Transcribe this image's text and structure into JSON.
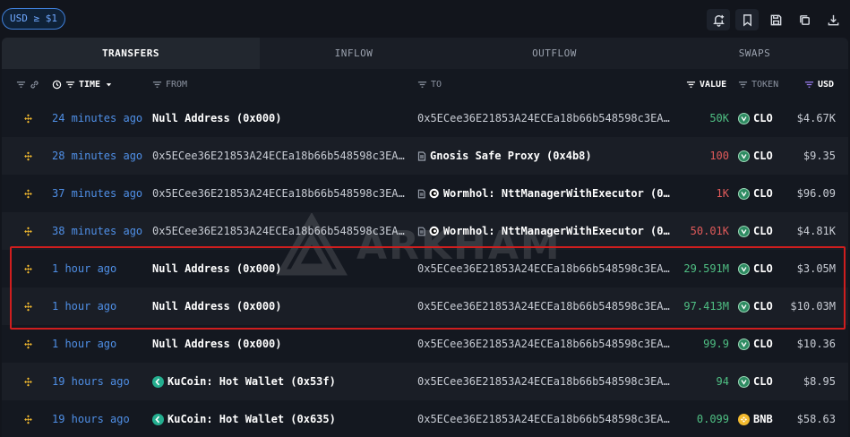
{
  "filter": {
    "label": "USD ≥ $1"
  },
  "toolbar": {
    "icons": [
      "notification-add-icon",
      "bookmark-icon",
      "save-icon",
      "copy-icon",
      "download-icon"
    ]
  },
  "tabs": [
    {
      "label": "TRANSFERS",
      "active": true
    },
    {
      "label": "INFLOW",
      "active": false
    },
    {
      "label": "OUTFLOW",
      "active": false
    },
    {
      "label": "SWAPS",
      "active": false
    }
  ],
  "columns": {
    "time": "TIME",
    "from": "FROM",
    "to": "TO",
    "value": "VALUE",
    "token": "TOKEN",
    "usd": "USD"
  },
  "watermark": "ARKHAM",
  "colors": {
    "accent_blue": "#4f8fe6",
    "positive_green": "#4fbf83",
    "negative_red": "#e05a5a",
    "highlight_red": "#d01e1e",
    "chain_bnb_yellow": "#f3ba2f",
    "kucoin_green": "#24ae8f",
    "clo_token_green": "#2e8b62"
  },
  "rows": [
    {
      "time": "24 minutes ago",
      "from": "Null Address (0x000)",
      "from_type": "entity",
      "to": "0x5ECee36E21853A24ECEa18b66b548598c3EA...",
      "to_type": "address",
      "value": "50K",
      "value_color": "green",
      "token": "CLO",
      "usd": "$4.67K"
    },
    {
      "time": "28 minutes ago",
      "from": "0x5ECee36E21853A24ECEa18b66b548598c3EA...",
      "from_type": "address",
      "to": "Gnosis Safe Proxy (0x4b8)",
      "to_type": "contract",
      "value": "100",
      "value_color": "red",
      "token": "CLO",
      "usd": "$9.35"
    },
    {
      "time": "37 minutes ago",
      "from": "0x5ECee36E21853A24ECEa18b66b548598c3EA...",
      "from_type": "address",
      "to": "Wormhol: NttManagerWithExecutor (0...",
      "to_type": "contract-wormhole",
      "value": "1K",
      "value_color": "red",
      "token": "CLO",
      "usd": "$96.09"
    },
    {
      "time": "38 minutes ago",
      "from": "0x5ECee36E21853A24ECEa18b66b548598c3EA...",
      "from_type": "address",
      "to": "Wormhol: NttManagerWithExecutor (0...",
      "to_type": "contract-wormhole",
      "value": "50.01K",
      "value_color": "red",
      "token": "CLO",
      "usd": "$4.81K"
    },
    {
      "time": "1 hour ago",
      "from": "Null Address (0x000)",
      "from_type": "entity",
      "to": "0x5ECee36E21853A24ECEa18b66b548598c3EA...",
      "to_type": "address",
      "value": "29.591M",
      "value_color": "green",
      "token": "CLO",
      "usd": "$3.05M"
    },
    {
      "time": "1 hour ago",
      "from": "Null Address (0x000)",
      "from_type": "entity",
      "to": "0x5ECee36E21853A24ECEa18b66b548598c3EA...",
      "to_type": "address",
      "value": "97.413M",
      "value_color": "green",
      "token": "CLO",
      "usd": "$10.03M"
    },
    {
      "time": "1 hour ago",
      "from": "Null Address (0x000)",
      "from_type": "entity",
      "to": "0x5ECee36E21853A24ECEa18b66b548598c3EA...",
      "to_type": "address",
      "value": "99.9",
      "value_color": "green",
      "token": "CLO",
      "usd": "$10.36"
    },
    {
      "time": "19 hours ago",
      "from": "KuCoin: Hot Wallet (0x53f)",
      "from_type": "kucoin",
      "to": "0x5ECee36E21853A24ECEa18b66b548598c3EA...",
      "to_type": "address",
      "value": "94",
      "value_color": "green",
      "token": "CLO",
      "usd": "$8.95"
    },
    {
      "time": "19 hours ago",
      "from": "KuCoin: Hot Wallet (0x635)",
      "from_type": "kucoin",
      "to": "0x5ECee36E21853A24ECEa18b66b548598c3EA...",
      "to_type": "address",
      "value": "0.099",
      "value_color": "green",
      "token": "BNB",
      "usd": "$58.63"
    }
  ]
}
